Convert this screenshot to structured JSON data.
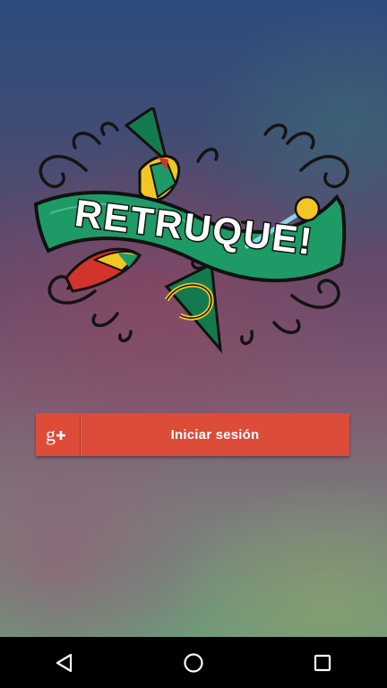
{
  "logo": {
    "text": "RETRUQUE!",
    "colors": {
      "banner": "#1e9a66",
      "banner_dark": "#137a4d",
      "ink": "#111111",
      "text": "#ffffff",
      "accent_yellow": "#f3c623",
      "accent_red": "#d2332d"
    }
  },
  "login": {
    "label": "Iniciar sesión",
    "icon": "google-plus-icon",
    "color": "#dd4b39"
  },
  "nav": {
    "back_icon": "back-triangle-icon",
    "home_icon": "home-circle-icon",
    "recents_icon": "recents-square-icon"
  }
}
